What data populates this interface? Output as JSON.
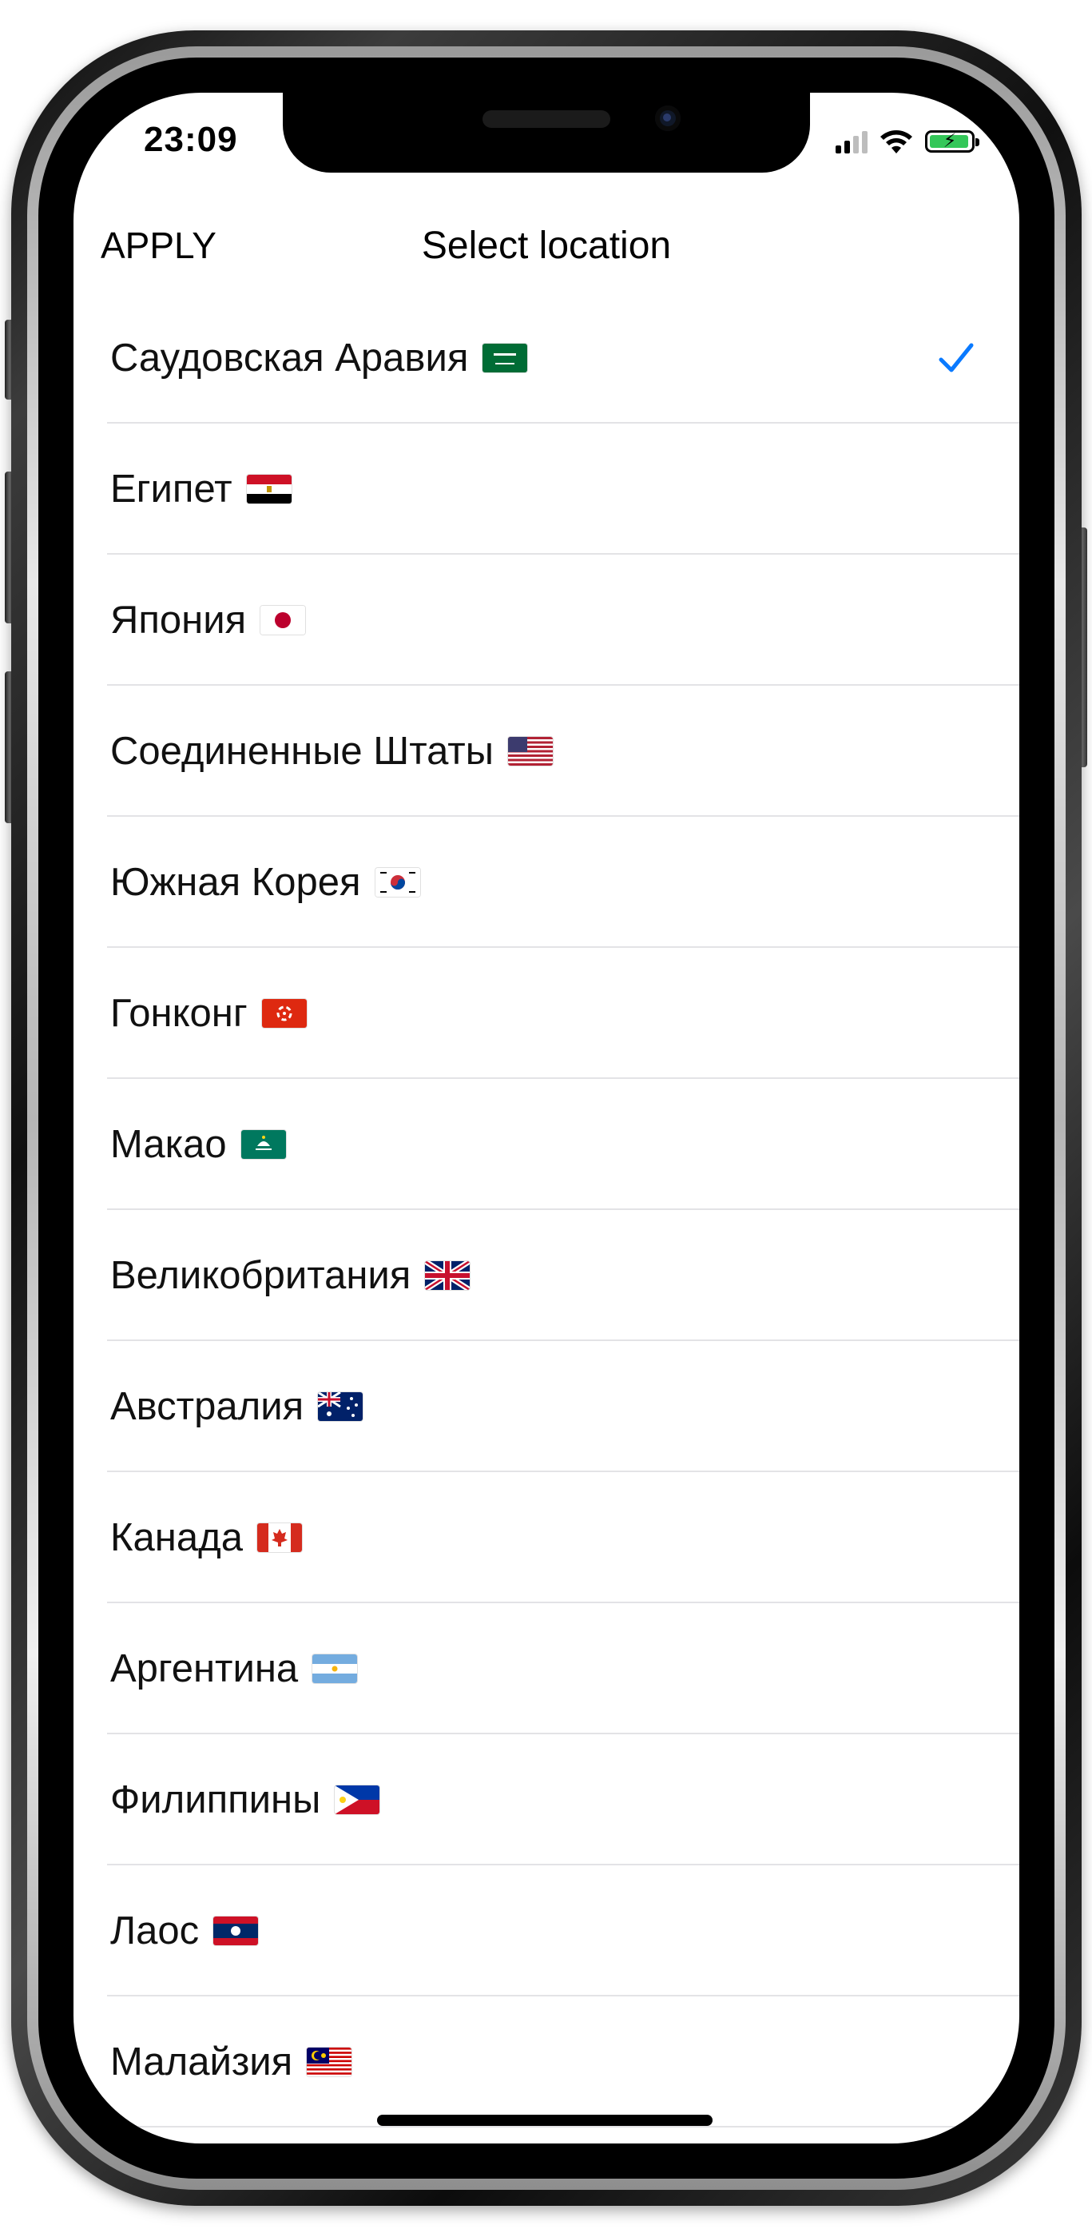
{
  "status_bar": {
    "time": "23:09"
  },
  "nav": {
    "apply_label": "APPLY",
    "title": "Select location"
  },
  "colors": {
    "accent": "#0a7aff",
    "separator": "#e3e3e6",
    "battery": "#34c759"
  },
  "locations": [
    {
      "name": "Саудовская Аравия",
      "flag": "saudi-arabia-flag-icon",
      "selected": true
    },
    {
      "name": "Египет",
      "flag": "egypt-flag-icon",
      "selected": false
    },
    {
      "name": "Япония",
      "flag": "japan-flag-icon",
      "selected": false
    },
    {
      "name": "Соединенные Штаты",
      "flag": "usa-flag-icon",
      "selected": false
    },
    {
      "name": "Южная Корея",
      "flag": "south-korea-flag-icon",
      "selected": false
    },
    {
      "name": "Гонконг",
      "flag": "hong-kong-flag-icon",
      "selected": false
    },
    {
      "name": "Макао",
      "flag": "macau-flag-icon",
      "selected": false
    },
    {
      "name": "Великобритания",
      "flag": "uk-flag-icon",
      "selected": false
    },
    {
      "name": "Австралия",
      "flag": "australia-flag-icon",
      "selected": false
    },
    {
      "name": "Канада",
      "flag": "canada-flag-icon",
      "selected": false
    },
    {
      "name": "Аргентина",
      "flag": "argentina-flag-icon",
      "selected": false
    },
    {
      "name": "Филиппины",
      "flag": "philippines-flag-icon",
      "selected": false
    },
    {
      "name": "Лаос",
      "flag": "laos-flag-icon",
      "selected": false
    },
    {
      "name": "Малайзия",
      "flag": "malaysia-flag-icon",
      "selected": false
    }
  ]
}
